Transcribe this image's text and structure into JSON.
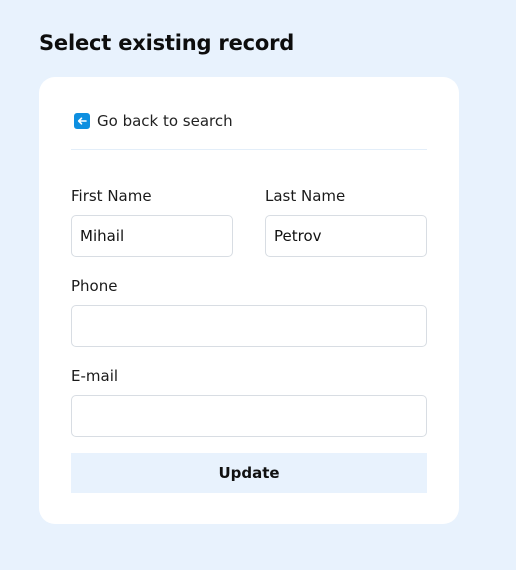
{
  "page": {
    "title": "Select existing record"
  },
  "back_link": {
    "label": "Go back to search",
    "icon": "arrow-left-icon",
    "icon_color": "#0e8fe0"
  },
  "form": {
    "first_name": {
      "label": "First Name",
      "value": "Mihail"
    },
    "last_name": {
      "label": "Last Name",
      "value": "Petrov"
    },
    "phone": {
      "label": "Phone",
      "value": ""
    },
    "email": {
      "label": "E-mail",
      "value": ""
    },
    "submit_label": "Update"
  },
  "colors": {
    "background": "#e8f2fd",
    "card": "#ffffff",
    "button_background": "#e8f2fd"
  }
}
